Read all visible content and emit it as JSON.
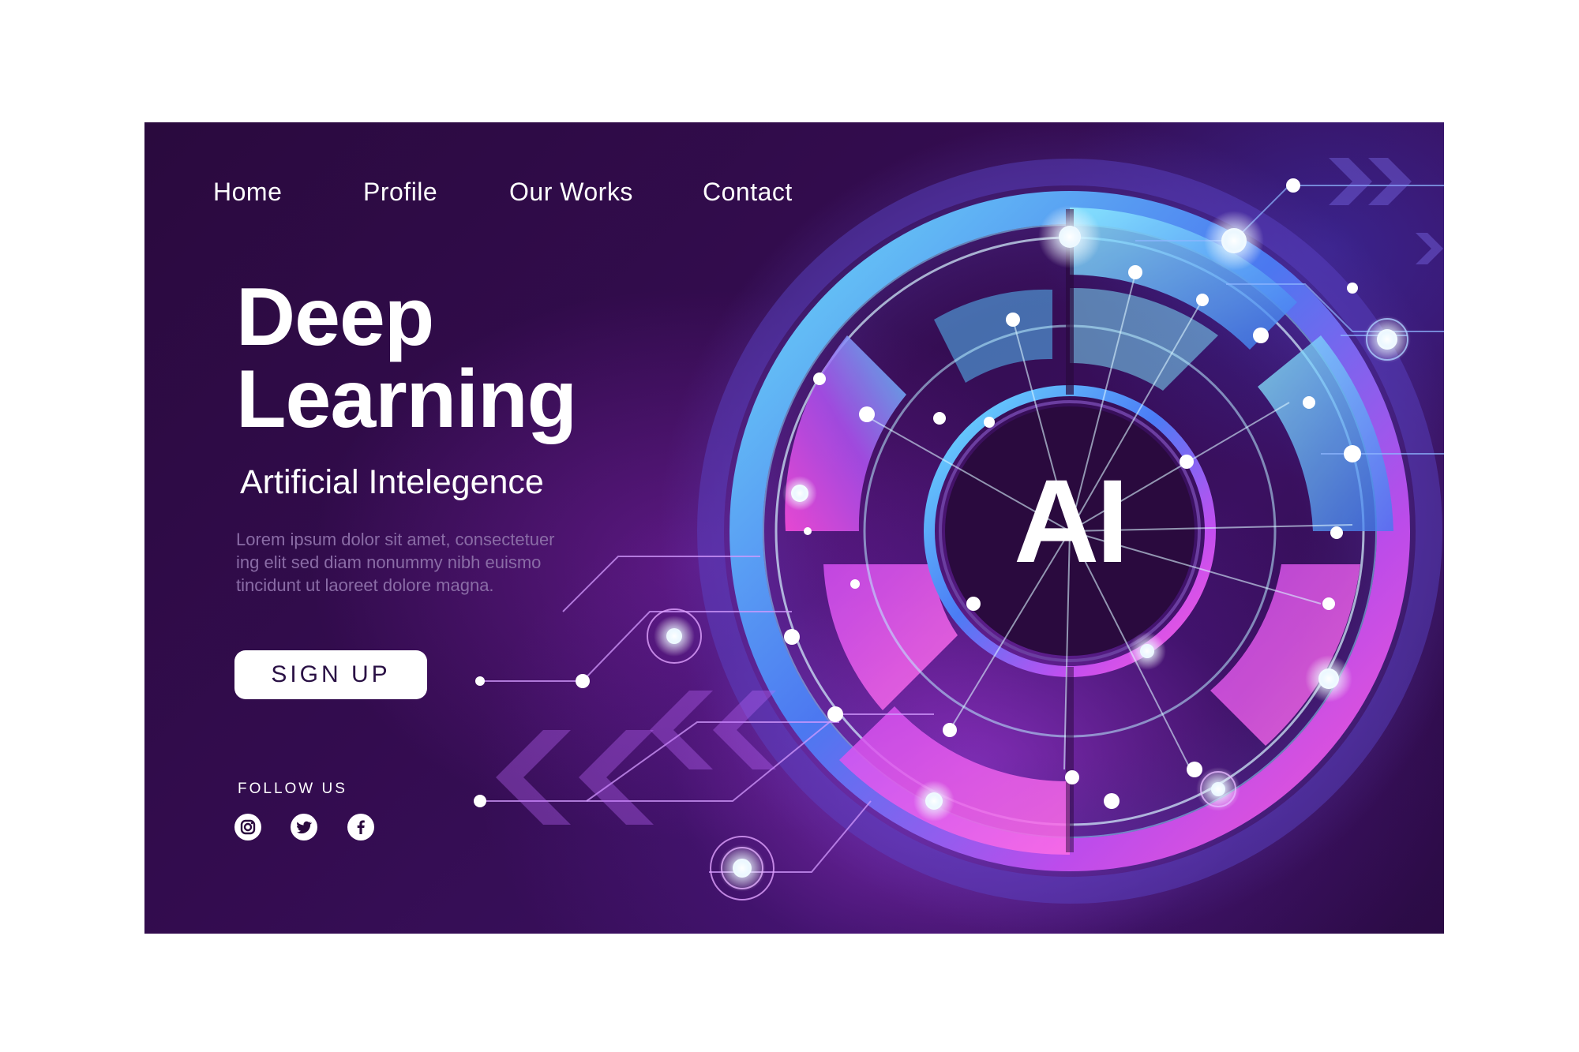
{
  "nav": {
    "items": [
      {
        "label": "Home"
      },
      {
        "label": "Profile"
      },
      {
        "label": "Our Works"
      },
      {
        "label": "Contact"
      }
    ]
  },
  "hero": {
    "title_line1": "Deep",
    "title_line2": "Learning",
    "subtitle": "Artificial Intelegence",
    "body_lines": [
      "Lorem ipsum dolor sit amet, consectetuer",
      "ing elit sed diam nonummy nibh euismo",
      "tincidunt ut laoreet dolore magna."
    ],
    "cta_label": "SIGN UP"
  },
  "social": {
    "heading": "FOLLOW US",
    "icons": [
      "instagram-icon",
      "twitter-icon",
      "facebook-icon"
    ]
  },
  "graphic": {
    "center_label": "AI"
  },
  "colors": {
    "background": "#2c0b43",
    "accent_cyan": "#5fd8ff",
    "accent_blue": "#3d6bf2",
    "accent_magenta": "#e24bf0",
    "button_bg": "#ffffff",
    "button_text": "#2a1145"
  }
}
